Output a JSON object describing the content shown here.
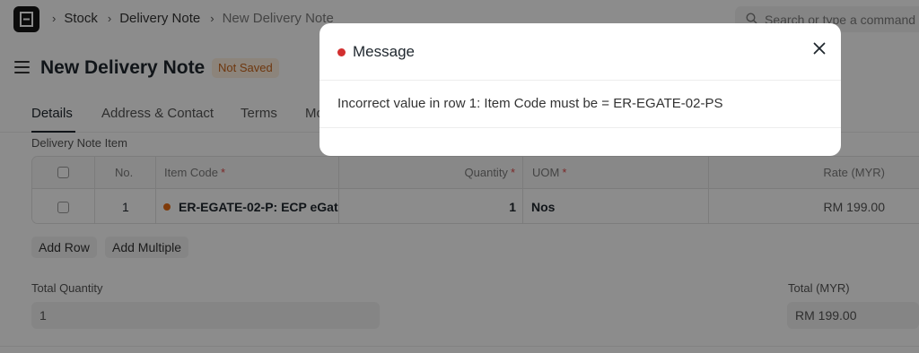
{
  "navbar": {
    "breadcrumbs": [
      "Stock",
      "Delivery Note",
      "New Delivery Note"
    ],
    "search_placeholder": "Search or type a command"
  },
  "page": {
    "title": "New Delivery Note",
    "status": "Not Saved"
  },
  "tabs": [
    "Details",
    "Address & Contact",
    "Terms",
    "Mo"
  ],
  "items_table": {
    "label": "Delivery Note Item",
    "headers": {
      "no": "No.",
      "item_code": "Item Code",
      "quantity": "Quantity",
      "uom": "UOM",
      "rate": "Rate (MYR)"
    },
    "required_mark": "*",
    "rows": [
      {
        "no": "1",
        "item_code": "ER-EGATE-02-P: ECP eGat",
        "quantity": "1",
        "uom": "Nos",
        "rate": "RM 199.00"
      }
    ],
    "add_row": "Add Row",
    "add_multiple": "Add Multiple"
  },
  "totals": {
    "total_quantity_label": "Total Quantity",
    "total_quantity_value": "1",
    "total_label": "Total (MYR)",
    "total_value": "RM 199.00"
  },
  "modal": {
    "title": "Message",
    "message": "Incorrect value in row 1: Item Code must be = ER-EGATE-02-PS",
    "indicator_color": "#d22f2f"
  },
  "colors": {
    "status_text": "#c8641b",
    "status_bg": "#fff0e0",
    "item_dot": "#e86c13",
    "required": "#e24c4c"
  }
}
